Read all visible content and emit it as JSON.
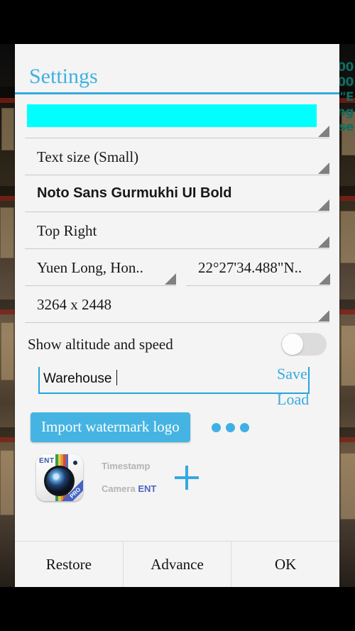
{
  "background": {
    "overlay_text_lines": [
      "00",
      "00",
      "\"E",
      "ng",
      "ise"
    ]
  },
  "dialog": {
    "title": "Settings",
    "rows": [
      {
        "name": "watermark-color",
        "value": "",
        "highlighted": true
      },
      {
        "name": "text-size",
        "value": "Text size (Small)",
        "highlighted": false
      },
      {
        "name": "font-family",
        "value": "Noto Sans Gurmukhi UI Bold",
        "highlighted": false,
        "bold": true
      },
      {
        "name": "position",
        "value": "Top  Right",
        "highlighted": false
      }
    ],
    "location_row": {
      "location": "Yuen Long, Hon..",
      "coordinates": "22°27'34.488\"N.."
    },
    "resolution": "3264 x 2448",
    "altitude": {
      "label": "Show altitude and speed",
      "enabled": false
    },
    "note_input": {
      "value": "Warehouse",
      "placeholder": ""
    },
    "save_label": "Save",
    "load_label": "Load",
    "import_button": "Import watermark logo",
    "overflow_dots": "more-options",
    "logo_item": {
      "icon_badge": "ENT",
      "icon_ribbon": "PRO",
      "caption_line1": "Timestamp",
      "caption_line2_plain": "Camera ",
      "caption_line2_bold": "ENT"
    },
    "add_label": "+",
    "buttons": [
      {
        "name": "restore",
        "label": "Restore"
      },
      {
        "name": "advance",
        "label": "Advance"
      },
      {
        "name": "ok",
        "label": "OK"
      }
    ]
  },
  "colors": {
    "accent": "#3fb1e3",
    "highlight": "#00ffff",
    "button_blue": "#45b4e2",
    "dialog_bg": "#f4f4f4"
  }
}
